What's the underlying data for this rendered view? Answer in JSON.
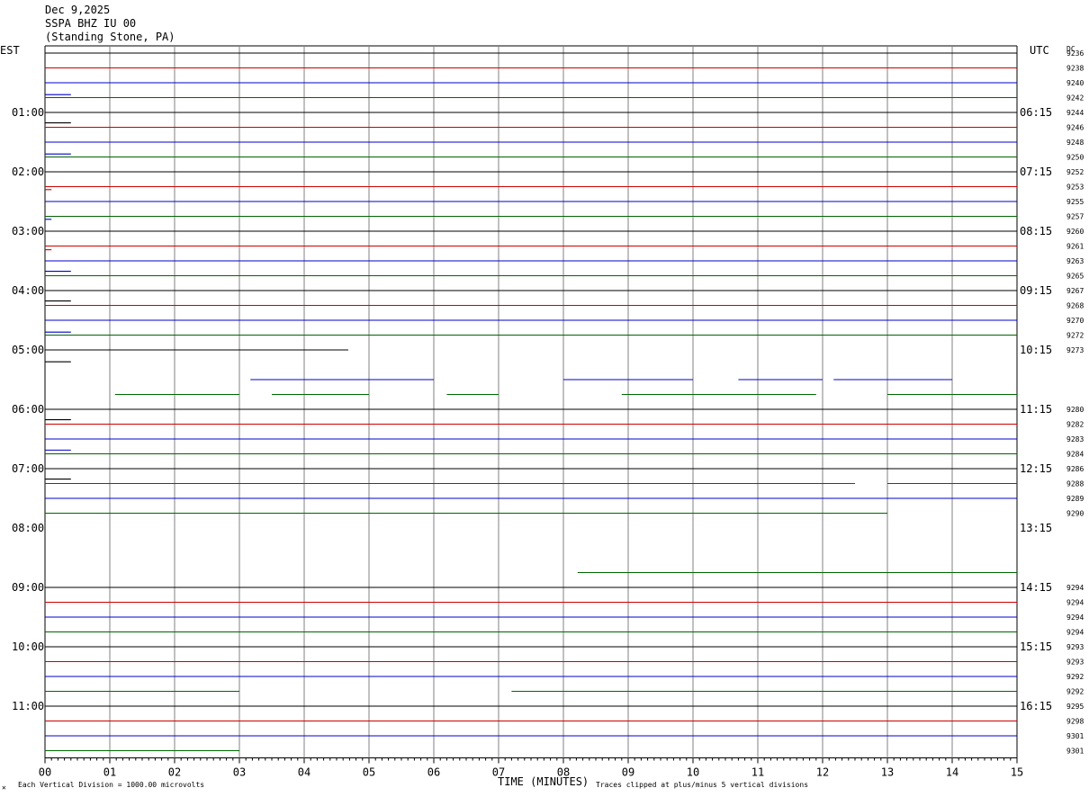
{
  "header": {
    "date": "Dec 9,2025",
    "station": "SSPA BHZ IU 00",
    "location": "(Standing Stone, PA)"
  },
  "axes": {
    "left_tz": "EST",
    "right_tz": "UTC",
    "dc_header": "DC",
    "xlabel": "TIME (MINUTES)",
    "footer_left": "Each Vertical Division = 1000.00 microvolts",
    "footer_right": "Traces clipped at plus/minus 5 vertical divisions",
    "corner_mark": "✕"
  },
  "colors": {
    "black": "#000000",
    "red": "#cc0000",
    "blue": "#0000cc",
    "green": "#006600",
    "grid": "#808080"
  },
  "chart_data": {
    "type": "line",
    "title": "SSPA BHZ IU 00",
    "xlabel": "TIME (MINUTES)",
    "xlim": [
      0,
      15
    ],
    "x_ticks": [
      "00",
      "01",
      "02",
      "03",
      "04",
      "05",
      "06",
      "07",
      "08",
      "09",
      "10",
      "11",
      "12",
      "13",
      "14",
      "15"
    ],
    "row_interval_minutes": 15,
    "rows_total": 48,
    "hour_labels": [
      {
        "row": 4,
        "est": "01:00",
        "utc": "06:15"
      },
      {
        "row": 8,
        "est": "02:00",
        "utc": "07:15"
      },
      {
        "row": 12,
        "est": "03:00",
        "utc": "08:15"
      },
      {
        "row": 16,
        "est": "04:00",
        "utc": "09:15"
      },
      {
        "row": 20,
        "est": "05:00",
        "utc": "10:15"
      },
      {
        "row": 24,
        "est": "06:00",
        "utc": "11:15"
      },
      {
        "row": 28,
        "est": "07:00",
        "utc": "12:15"
      },
      {
        "row": 32,
        "est": "08:00",
        "utc": "13:15"
      },
      {
        "row": 36,
        "est": "09:00",
        "utc": "14:15"
      },
      {
        "row": 40,
        "est": "10:00",
        "utc": "15:15"
      },
      {
        "row": 44,
        "est": "11:00",
        "utc": "16:15"
      }
    ],
    "dc_values": [
      {
        "row": 0,
        "text": "9236"
      },
      {
        "row": 1,
        "text": "9238"
      },
      {
        "row": 2,
        "text": "9240"
      },
      {
        "row": 3,
        "text": "9242"
      },
      {
        "row": 4,
        "text": "9244"
      },
      {
        "row": 5,
        "text": "9246"
      },
      {
        "row": 6,
        "text": "9248"
      },
      {
        "row": 7,
        "text": "9250"
      },
      {
        "row": 8,
        "text": "9252"
      },
      {
        "row": 9,
        "text": "9253"
      },
      {
        "row": 10,
        "text": "9255"
      },
      {
        "row": 11,
        "text": "9257"
      },
      {
        "row": 12,
        "text": "9260"
      },
      {
        "row": 13,
        "text": "9261"
      },
      {
        "row": 14,
        "text": "9263"
      },
      {
        "row": 15,
        "text": "9265"
      },
      {
        "row": 16,
        "text": "9267"
      },
      {
        "row": 17,
        "text": "9268"
      },
      {
        "row": 18,
        "text": "9270"
      },
      {
        "row": 19,
        "text": "9272"
      },
      {
        "row": 20,
        "text": "9273"
      },
      {
        "row": 24,
        "text": "9280"
      },
      {
        "row": 25,
        "text": "9282"
      },
      {
        "row": 26,
        "text": "9283"
      },
      {
        "row": 27,
        "text": "9284"
      },
      {
        "row": 28,
        "text": "9286"
      },
      {
        "row": 29,
        "text": "9288"
      },
      {
        "row": 30,
        "text": "9289"
      },
      {
        "row": 31,
        "text": "9290"
      },
      {
        "row": 36,
        "text": "9294"
      },
      {
        "row": 37,
        "text": "9294"
      },
      {
        "row": 38,
        "text": "9294"
      },
      {
        "row": 39,
        "text": "9294"
      },
      {
        "row": 40,
        "text": "9293"
      },
      {
        "row": 41,
        "text": "9293"
      },
      {
        "row": 42,
        "text": "9292"
      },
      {
        "row": 43,
        "text": "9292"
      },
      {
        "row": 44,
        "text": "9295"
      },
      {
        "row": 45,
        "text": "9298"
      },
      {
        "row": 46,
        "text": "9301"
      },
      {
        "row": 47,
        "text": "9301"
      }
    ],
    "traces": [
      {
        "row": 0,
        "color": "black",
        "segments": [
          [
            0,
            15
          ]
        ]
      },
      {
        "row": 1,
        "color": "red",
        "segments": [
          [
            0,
            15
          ]
        ]
      },
      {
        "row": 2,
        "color": "blue",
        "segments": [
          [
            0,
            15
          ]
        ]
      },
      {
        "row": 3,
        "color": "green",
        "segments": [
          [
            0,
            15
          ]
        ]
      },
      {
        "row": 4,
        "color": "black",
        "segments": [
          [
            0,
            15
          ]
        ]
      },
      {
        "row": 5,
        "color": "red",
        "segments": [
          [
            0,
            15
          ]
        ]
      },
      {
        "row": 6,
        "color": "blue",
        "segments": [
          [
            0,
            15
          ]
        ]
      },
      {
        "row": 7,
        "color": "green",
        "segments": [
          [
            0,
            15
          ]
        ]
      },
      {
        "row": 8,
        "color": "black",
        "segments": [
          [
            0,
            15
          ]
        ]
      },
      {
        "row": 9,
        "color": "red",
        "segments": [
          [
            0,
            15
          ]
        ]
      },
      {
        "row": 10,
        "color": "blue",
        "segments": [
          [
            0,
            15
          ]
        ]
      },
      {
        "row": 11,
        "color": "green",
        "segments": [
          [
            0,
            15
          ]
        ]
      },
      {
        "row": 12,
        "color": "black",
        "segments": [
          [
            0,
            15
          ]
        ]
      },
      {
        "row": 13,
        "color": "red",
        "segments": [
          [
            0,
            15
          ]
        ]
      },
      {
        "row": 14,
        "color": "blue",
        "segments": [
          [
            0,
            15
          ]
        ]
      },
      {
        "row": 15,
        "color": "green",
        "segments": [
          [
            0,
            15
          ]
        ]
      },
      {
        "row": 16,
        "color": "black",
        "segments": [
          [
            0,
            15
          ]
        ]
      },
      {
        "row": 17,
        "color": "red",
        "segments": [
          [
            0,
            15
          ]
        ]
      },
      {
        "row": 18,
        "color": "blue",
        "segments": [
          [
            0,
            15
          ]
        ]
      },
      {
        "row": 19,
        "color": "green",
        "segments": [
          [
            0,
            15
          ]
        ]
      },
      {
        "row": 20,
        "color": "black",
        "segments": [
          [
            0,
            4.68
          ]
        ]
      },
      {
        "row": 22,
        "color": "blue",
        "segments": [
          [
            3.17,
            6.0
          ],
          [
            8.0,
            10.0
          ],
          [
            10.7,
            12.0
          ],
          [
            12.17,
            14.0
          ]
        ]
      },
      {
        "row": 23,
        "color": "green",
        "segments": [
          [
            1.08,
            3.0
          ],
          [
            3.5,
            5.0
          ],
          [
            6.2,
            7.0
          ],
          [
            8.9,
            11.9
          ],
          [
            13.0,
            15.0
          ]
        ]
      },
      {
        "row": 24,
        "color": "black",
        "segments": [
          [
            0,
            15
          ]
        ]
      },
      {
        "row": 25,
        "color": "red",
        "segments": [
          [
            0,
            15
          ]
        ]
      },
      {
        "row": 26,
        "color": "blue",
        "segments": [
          [
            0,
            15
          ]
        ]
      },
      {
        "row": 27,
        "color": "green",
        "segments": [
          [
            0,
            15
          ]
        ]
      },
      {
        "row": 28,
        "color": "black",
        "segments": [
          [
            0,
            15
          ]
        ]
      },
      {
        "row": 29,
        "color": "red",
        "segments": [
          [
            0,
            12.5
          ],
          [
            13.0,
            15.0
          ]
        ]
      },
      {
        "row": 30,
        "color": "blue",
        "segments": [
          [
            0,
            15
          ]
        ]
      },
      {
        "row": 31,
        "color": "green",
        "segments": [
          [
            0,
            13.0
          ]
        ]
      },
      {
        "row": 35,
        "color": "green",
        "segments": [
          [
            8.22,
            15.0
          ]
        ]
      },
      {
        "row": 36,
        "color": "black",
        "segments": [
          [
            0,
            15
          ]
        ]
      },
      {
        "row": 37,
        "color": "red",
        "segments": [
          [
            0,
            15
          ]
        ]
      },
      {
        "row": 38,
        "color": "blue",
        "segments": [
          [
            0,
            15
          ]
        ]
      },
      {
        "row": 39,
        "color": "green",
        "segments": [
          [
            0,
            15
          ]
        ]
      },
      {
        "row": 40,
        "color": "black",
        "segments": [
          [
            0,
            15
          ]
        ]
      },
      {
        "row": 41,
        "color": "red",
        "segments": [
          [
            0,
            15
          ]
        ]
      },
      {
        "row": 42,
        "color": "blue",
        "segments": [
          [
            0,
            15
          ]
        ]
      },
      {
        "row": 43,
        "color": "green",
        "segments": [
          [
            0,
            3.0
          ],
          [
            7.2,
            15.0
          ]
        ]
      },
      {
        "row": 44,
        "color": "black",
        "segments": [
          [
            0,
            15
          ]
        ]
      },
      {
        "row": 45,
        "color": "red",
        "segments": [
          [
            0,
            15
          ]
        ]
      },
      {
        "row": 46,
        "color": "blue",
        "segments": [
          [
            0,
            15
          ]
        ]
      },
      {
        "row": 47,
        "color": "green",
        "segments": [
          [
            0,
            3.0
          ]
        ]
      }
    ],
    "pulses": [
      {
        "row": 2,
        "color": "blue",
        "offset": 0.8,
        "x": [
          0,
          0.4
        ]
      },
      {
        "row": 4,
        "color": "black",
        "offset": 0.7,
        "x": [
          0,
          0.4
        ]
      },
      {
        "row": 6,
        "color": "blue",
        "offset": 0.8,
        "x": [
          0,
          0.4
        ]
      },
      {
        "row": 9,
        "color": "red",
        "offset": 0.2,
        "x": [
          0,
          0.1
        ]
      },
      {
        "row": 11,
        "color": "blue",
        "offset": 0.2,
        "x": [
          0,
          0.1
        ]
      },
      {
        "row": 13,
        "color": "red",
        "offset": 0.25,
        "x": [
          0,
          0.1
        ]
      },
      {
        "row": 14,
        "color": "blue",
        "offset": 0.7,
        "x": [
          0,
          0.4
        ]
      },
      {
        "row": 16,
        "color": "black",
        "offset": 0.7,
        "x": [
          0,
          0.4
        ]
      },
      {
        "row": 18,
        "color": "blue",
        "offset": 0.8,
        "x": [
          0,
          0.4
        ]
      },
      {
        "row": 20,
        "color": "black",
        "offset": 0.8,
        "x": [
          0,
          0.4
        ]
      },
      {
        "row": 24,
        "color": "black",
        "offset": 0.7,
        "x": [
          0,
          0.4
        ]
      },
      {
        "row": 26,
        "color": "blue",
        "offset": 0.75,
        "x": [
          0,
          0.4
        ]
      },
      {
        "row": 28,
        "color": "black",
        "offset": 0.7,
        "x": [
          0,
          0.4
        ]
      }
    ]
  }
}
